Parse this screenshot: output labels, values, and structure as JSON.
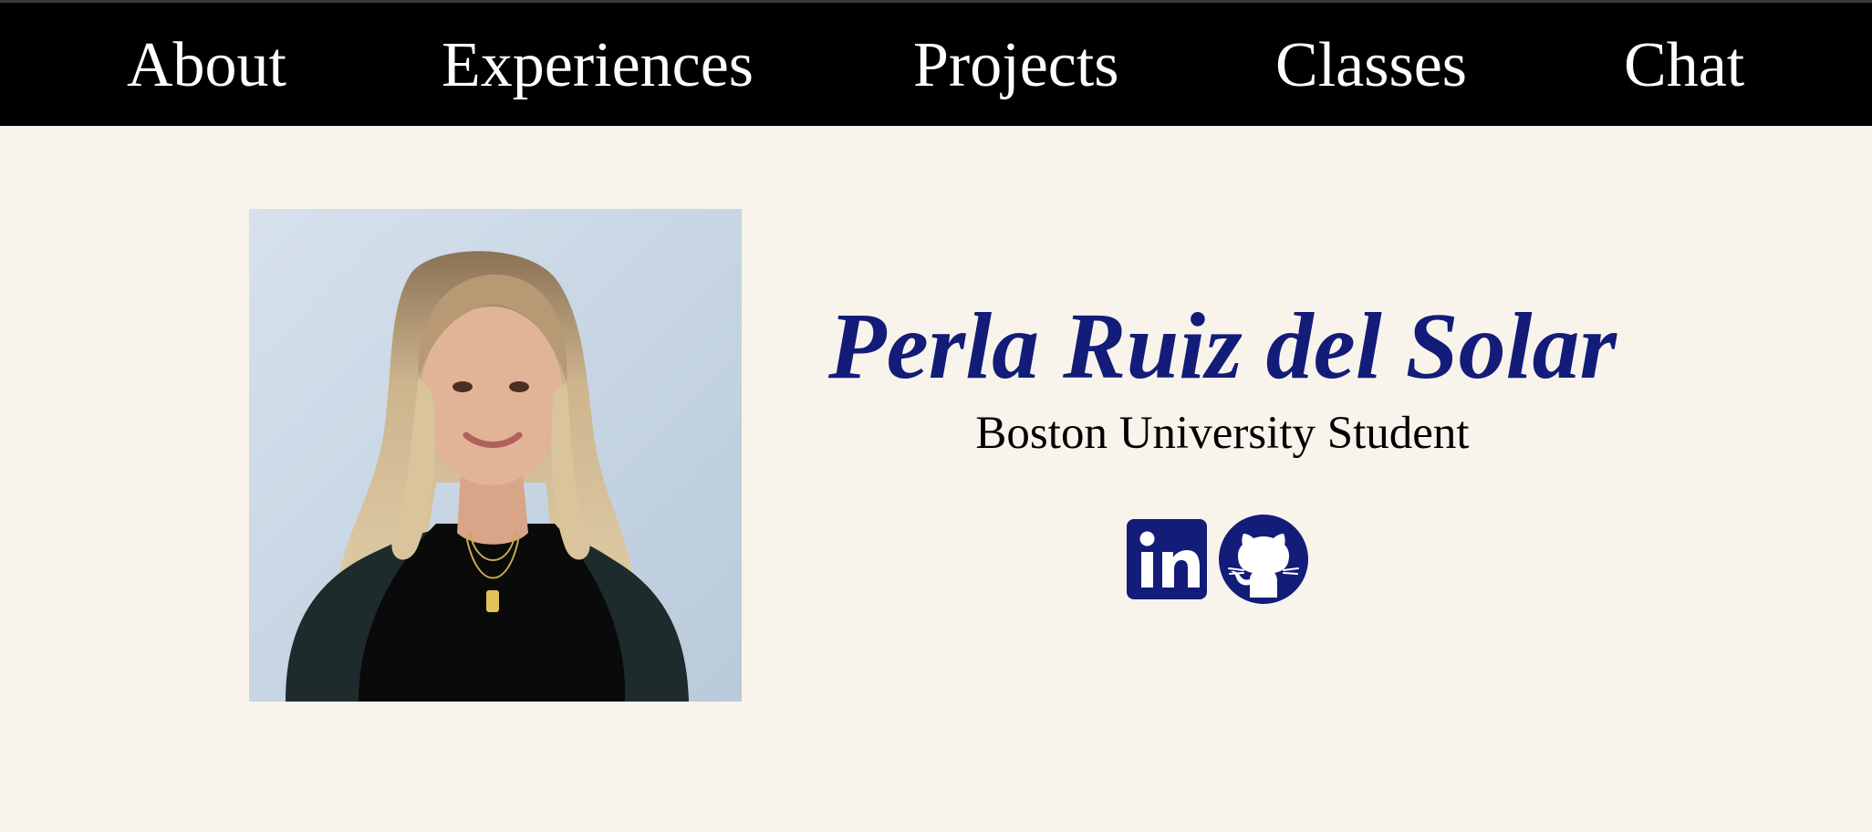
{
  "nav": {
    "items": [
      {
        "label": "About"
      },
      {
        "label": "Experiences"
      },
      {
        "label": "Projects"
      },
      {
        "label": "Classes"
      },
      {
        "label": "Chat"
      }
    ]
  },
  "profile": {
    "name": "Perla Ruiz del Solar",
    "subtitle": "Boston University Student"
  },
  "social": {
    "icons": [
      "linkedin-icon",
      "github-icon"
    ]
  },
  "colors": {
    "background": "#f8f4eb",
    "navbar": "#000000",
    "nav_text": "#ffffff",
    "accent_navy": "#131c79"
  }
}
